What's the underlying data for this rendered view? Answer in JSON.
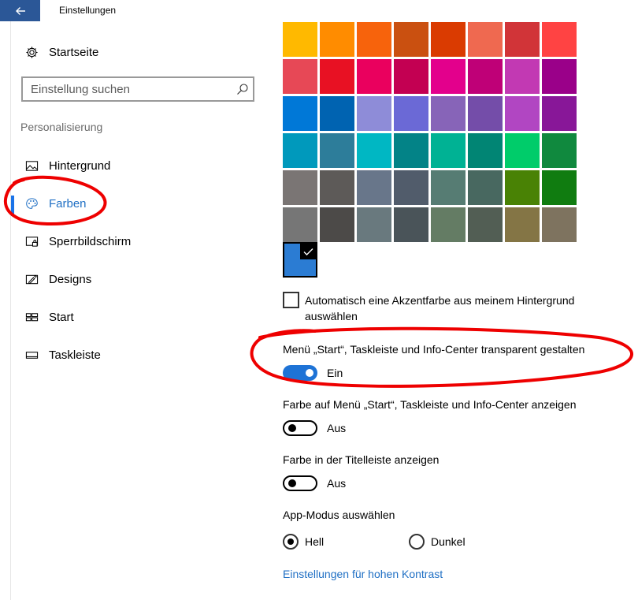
{
  "window": {
    "title": "Einstellungen",
    "back_icon": "arrow-left-icon"
  },
  "sidebar": {
    "home": {
      "label": "Startseite",
      "icon": "gear-icon"
    },
    "search": {
      "placeholder": "Einstellung suchen",
      "value": ""
    },
    "section": "Personalisierung",
    "items": [
      {
        "label": "Hintergrund",
        "icon": "picture-icon",
        "active": false
      },
      {
        "label": "Farben",
        "icon": "palette-icon",
        "active": true
      },
      {
        "label": "Sperrbildschirm",
        "icon": "lock-screen-icon",
        "active": false
      },
      {
        "label": "Designs",
        "icon": "brush-icon",
        "active": false
      },
      {
        "label": "Start",
        "icon": "start-tiles-icon",
        "active": false
      },
      {
        "label": "Taskleiste",
        "icon": "taskbar-icon",
        "active": false
      }
    ]
  },
  "colors": {
    "accent": "#1a73e8",
    "swatches": [
      "#ffb900",
      "#ff8c00",
      "#f7630c",
      "#ca5010",
      "#da3b01",
      "#ef6950",
      "#d13438",
      "#ff4343",
      "#e74856",
      "#e81123",
      "#ea005e",
      "#c30052",
      "#e3008c",
      "#bf0077",
      "#c239b3",
      "#9a0089",
      "#0078d7",
      "#0063b1",
      "#8e8cd8",
      "#6b69d6",
      "#8764b8",
      "#744da9",
      "#b146c2",
      "#881798",
      "#0099bc",
      "#2d7d9a",
      "#00b7c3",
      "#038387",
      "#00b294",
      "#018574",
      "#00cc6a",
      "#10893e",
      "#7a7574",
      "#5d5a58",
      "#68768a",
      "#515c6b",
      "#567c73",
      "#486860",
      "#498205",
      "#107c10",
      "#767676",
      "#4c4a48",
      "#69797e",
      "#4a5459",
      "#647c64",
      "#525e54",
      "#847545",
      "#7e735f"
    ],
    "selected_color": "#2b7cd3"
  },
  "settings": {
    "auto_accent": {
      "label": "Automatisch eine Akzentfarbe aus meinem Hintergrund auswählen",
      "checked": false
    },
    "transparency": {
      "label": "Menü „Start“, Taskleiste und Info-Center transparent gestalten",
      "state": "Ein",
      "on": true
    },
    "color_on_start": {
      "label": "Farbe auf Menü „Start“, Taskleiste und Info-Center anzeigen",
      "state": "Aus",
      "on": false
    },
    "color_titlebar": {
      "label": "Farbe in der Titelleiste anzeigen",
      "state": "Aus",
      "on": false
    },
    "app_mode": {
      "label": "App-Modus auswählen",
      "options": [
        "Hell",
        "Dunkel"
      ],
      "selected": "Hell"
    },
    "high_contrast_link": "Einstellungen für hohen Kontrast"
  }
}
